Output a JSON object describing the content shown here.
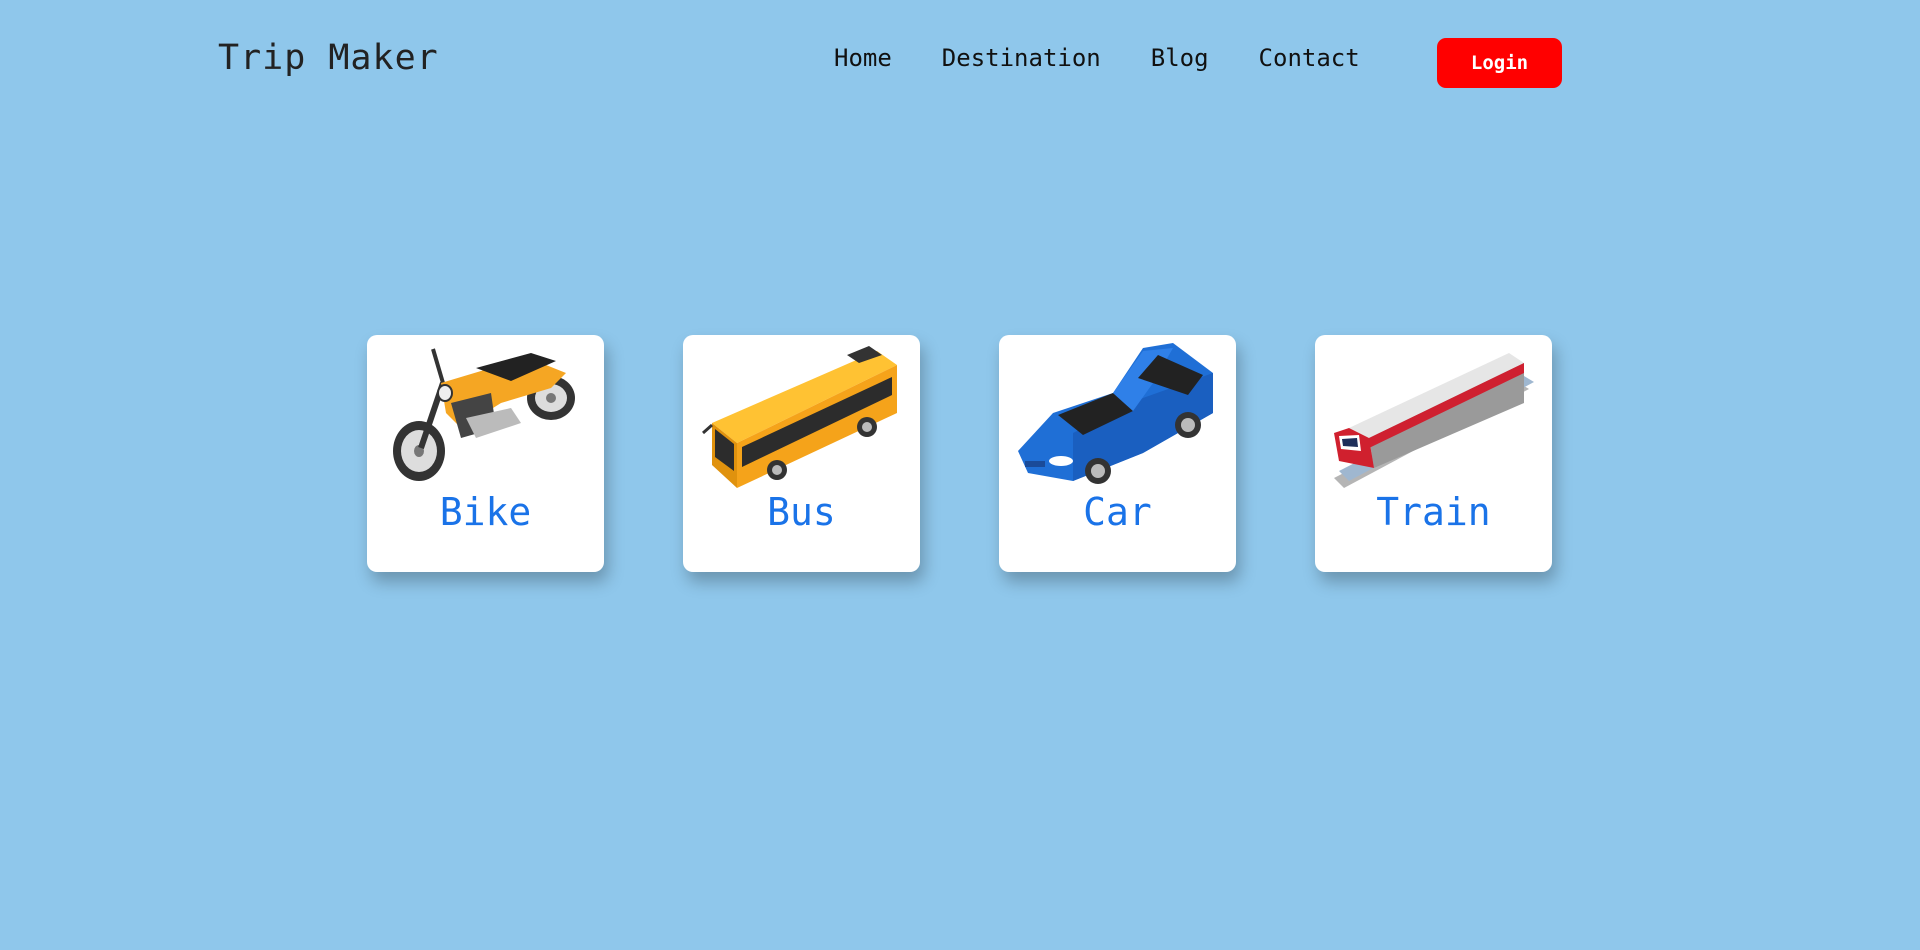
{
  "header": {
    "logo": "Trip Maker",
    "nav": [
      "Home",
      "Destination",
      "Blog",
      "Contact"
    ],
    "login_label": "Login"
  },
  "cards": [
    {
      "label": "Bike",
      "icon": "motorcycle-icon"
    },
    {
      "label": "Bus",
      "icon": "bus-icon"
    },
    {
      "label": "Car",
      "icon": "car-icon"
    },
    {
      "label": "Train",
      "icon": "train-icon"
    }
  ],
  "colors": {
    "background": "#8fc7eb",
    "login_button": "#ff0000",
    "card_label": "#1a73e8"
  }
}
